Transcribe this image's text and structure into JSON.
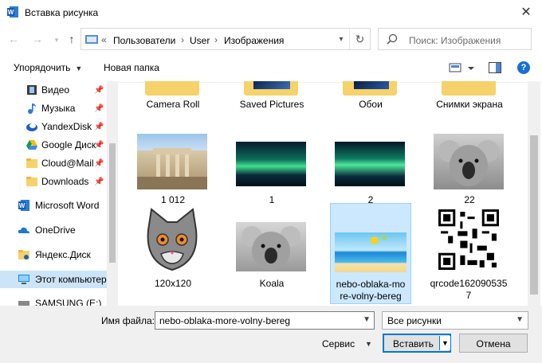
{
  "window": {
    "title": "Вставка рисунка",
    "close": "✕"
  },
  "nav": {
    "back": "←",
    "forward": "→",
    "up": "↑",
    "breadcrumb_overflow": "«",
    "crumbs": [
      "Пользователи",
      "User",
      "Изображения"
    ],
    "search_placeholder": "Поиск: Изображения"
  },
  "toolbar": {
    "organize": "Упорядочить",
    "new_folder": "Новая папка",
    "help": "?"
  },
  "sidebar": {
    "items": [
      {
        "label": "Видео",
        "icon": "video-icon",
        "pinned": true
      },
      {
        "label": "Музыка",
        "icon": "music-icon",
        "pinned": true
      },
      {
        "label": "YandexDisk",
        "icon": "yandexdisk-icon",
        "pinned": true
      },
      {
        "label": "Google Диск",
        "icon": "google-drive-icon",
        "pinned": true
      },
      {
        "label": "Cloud@Mail",
        "icon": "folder-icon",
        "pinned": true
      },
      {
        "label": "Downloads",
        "icon": "folder-icon",
        "pinned": true
      },
      {
        "label": "Microsoft Word",
        "icon": "word-icon",
        "pinned": false
      },
      {
        "label": "OneDrive",
        "icon": "onedrive-icon",
        "pinned": false
      },
      {
        "label": "Яндекс.Диск",
        "icon": "yandex-disk-icon",
        "pinned": false
      },
      {
        "label": "Этот компьютер",
        "icon": "computer-icon",
        "pinned": false,
        "selected": true
      },
      {
        "label": "SAMSUNG (E:)",
        "icon": "drive-icon",
        "pinned": false
      }
    ]
  },
  "files": {
    "folders": [
      "Camera Roll",
      "Saved Pictures",
      "Обои",
      "Снимки экрана"
    ],
    "row2": [
      "1 012",
      "1",
      "2",
      "22"
    ],
    "row3": [
      "120x120",
      "Koala",
      "nebo-oblaka-more-volny-bereg",
      "qrcode1620905357"
    ],
    "selected": "nebo-oblaka-more-volny-bereg"
  },
  "bottom": {
    "filename_label": "Имя файла:",
    "filename_value": "nebo-oblaka-more-volny-bereg",
    "filter": "Все рисунки",
    "service": "Сервис",
    "insert": "Вставить",
    "cancel": "Отмена"
  },
  "colors": {
    "selection": "#cce8ff",
    "accent": "#0078d7",
    "folder": "#f6d26a"
  }
}
